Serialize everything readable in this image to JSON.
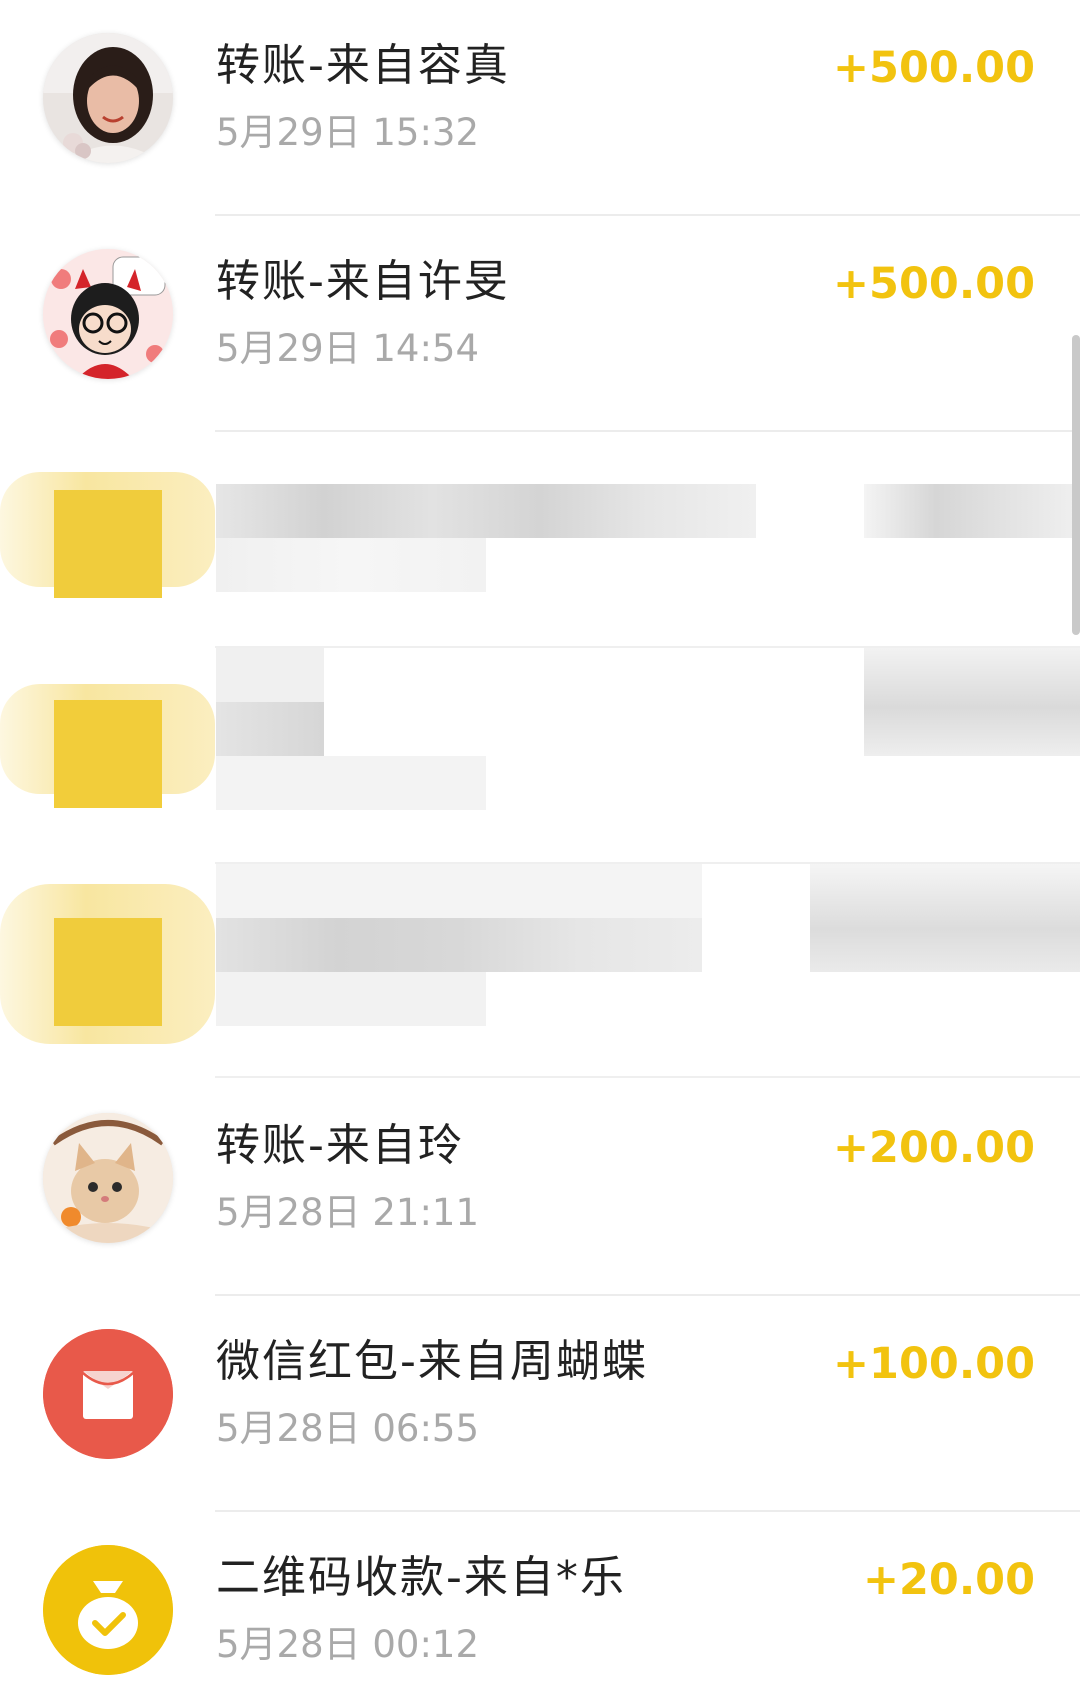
{
  "transactions": [
    {
      "title": "转账-来自容真",
      "time": "5月29日 15:32",
      "amount": "+500.00",
      "avatar": "photo-woman"
    },
    {
      "title": "转账-来自许旻",
      "time": "5月29日 14:54",
      "amount": "+500.00",
      "avatar": "cartoon-devil-glasses"
    },
    {
      "title": "转账-来自玲",
      "time": "5月28日 21:11",
      "amount": "+200.00",
      "avatar": "photo-cat"
    },
    {
      "title": "微信红包-来自周蝴蝶",
      "time": "5月28日 06:55",
      "amount": "+100.00",
      "avatar": "red-envelope-icon"
    },
    {
      "title": "二维码收款-来自*乐",
      "time": "5月28日 00:12",
      "amount": "+20.00",
      "avatar": "money-bag-check-icon"
    }
  ],
  "colors": {
    "amount": "#f2c30f",
    "title": "#222222",
    "time": "#a9a9a9",
    "red_envelope_bg": "#e8594a",
    "qr_bg": "#f0c20a"
  }
}
